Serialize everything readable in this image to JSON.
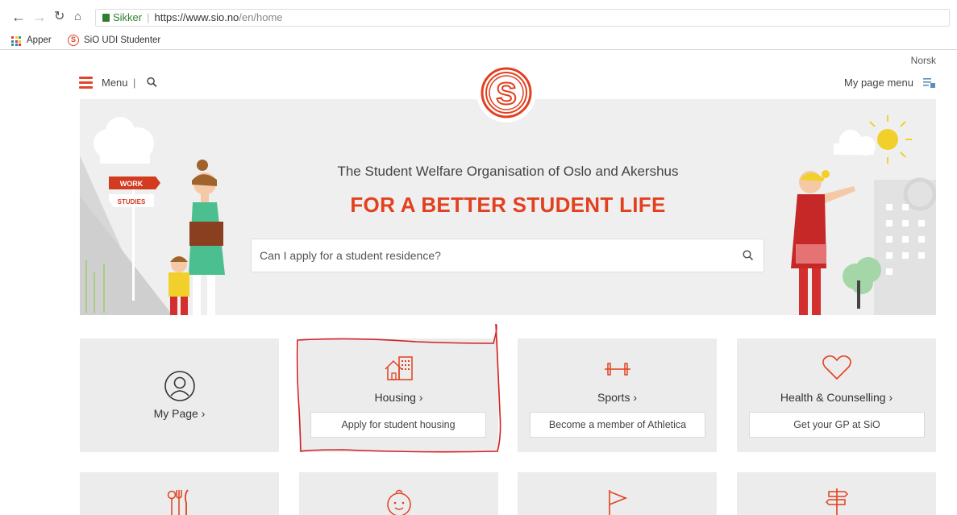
{
  "browser": {
    "secure_label": "Sikker",
    "url_main": "https://www.sio.no",
    "url_path": "/en/home",
    "bookmarks": [
      {
        "label": "Apper"
      },
      {
        "label": "SiO UDI Studenter"
      }
    ]
  },
  "header": {
    "language_link": "Norsk",
    "menu_label": "Menu",
    "menu_separator": "|",
    "my_page_menu": "My page menu"
  },
  "hero": {
    "subtitle": "The Student Welfare Organisation of Oslo and Akershus",
    "title": "FOR A BETTER STUDENT LIFE",
    "search_placeholder": "Can I apply for a student residence?",
    "sign_work": "WORK",
    "sign_studies": "STUDIES"
  },
  "tiles": [
    {
      "title": "My Page ›",
      "icon": "user-circle-icon"
    },
    {
      "title": "Housing ›",
      "button": "Apply for student housing",
      "icon": "house-icon"
    },
    {
      "title": "Sports ›",
      "button": "Become a member of Athletica",
      "icon": "dumbbell-icon"
    },
    {
      "title": "Health & Counselling ›",
      "button": "Get your GP at SiO",
      "icon": "heart-icon"
    }
  ],
  "tiles_row2_icons": [
    "cutlery-icon",
    "child-face-icon",
    "flag-icon",
    "signpost-icon"
  ],
  "colors": {
    "brand": "#e2401f",
    "tile_bg": "#ececec",
    "hero_bg": "#efefef",
    "annotation": "#d42020"
  }
}
